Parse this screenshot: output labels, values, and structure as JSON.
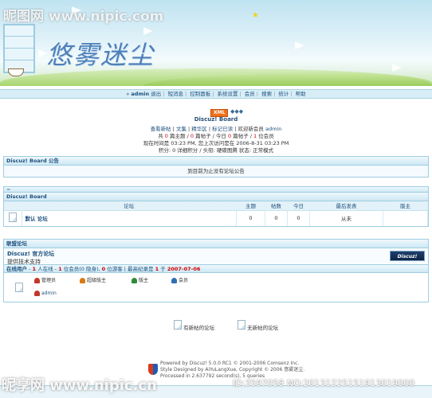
{
  "watermark_top": "昵图网 www.nipic.com",
  "watermark_bottom": "昵享网 www.nipic.cn",
  "watermark_id": "ID:3597058 NO:20131225151913019000",
  "banner_logo": "悠雾迷尘",
  "nav": {
    "user": "admin",
    "items": [
      "退出",
      "短消息",
      "控制面板",
      "系统设置",
      "会员",
      "搜索",
      "统计",
      "帮助"
    ]
  },
  "xml_badge": "XML",
  "dots": "◆◆◆",
  "board_name": "Discuz! Board",
  "info": {
    "line1": [
      "查看新帖",
      "文集",
      "精华区",
      "标记已读",
      "欢迎新会员"
    ],
    "new_member": "admin",
    "line2_prefix": "共",
    "topics": "0",
    "line2_mid1": "篇主题 /",
    "posts": "0",
    "line2_mid2": "篇帖子 / 今日",
    "today": "0",
    "line2_mid3": "篇帖子 /",
    "members": "1",
    "line2_end": "位会员",
    "line3": "现在时间是 03:23 PM, 您上次访问是在 2006-8-31 03:23 PM",
    "line4": "积分: 0 详细积分 / 头衔: 硬碟图腾 状态: 正常模式"
  },
  "announce": {
    "title": "Discuz! Board 公告",
    "text": "到目前为止没有论坛公告"
  },
  "forums": {
    "title": "Discuz! Board",
    "headers": [
      "论坛",
      "主题",
      "帖数",
      "今日",
      "最后发表",
      "版主"
    ],
    "rows": [
      {
        "name": "默认 论坛",
        "topics": "0",
        "posts": "0",
        "today": "0",
        "last": "从未",
        "mods": ""
      }
    ]
  },
  "league": {
    "title": "联盟论坛",
    "name": "Discuz! 官方论坛",
    "sub": "提供技术支持",
    "logo": "Discuz!"
  },
  "online": {
    "label": "在线用户",
    "count": "1",
    "text_mid": "人在线 -",
    "members": "1",
    "text_mid2": "位会员(0 隐身),",
    "guests": "0",
    "text_mid3": "位游客 | 最高纪录是",
    "record": "1",
    "text_mid4": "于",
    "record_date": "2007-07-06",
    "legend": [
      "管理员",
      "超级版主",
      "版主",
      "会员"
    ],
    "admin_user": "admin"
  },
  "bottom_legend": {
    "new": "有新帖的论坛",
    "none": "无新帖的论坛"
  },
  "footer": {
    "line1": "Powered by Discuz! 5.0.0 RC1 © 2001-2006 Comsenz Inc.",
    "line2": "Style Designed by AiYuLangXue, Copyright © 2006 悠雾迷尘.",
    "line3": "Processed in 2.637792 second(s), 5 queries"
  },
  "colors": {
    "accent": "#1d4f7d",
    "border": "#9fcde2",
    "highlight": "#cc0000"
  }
}
